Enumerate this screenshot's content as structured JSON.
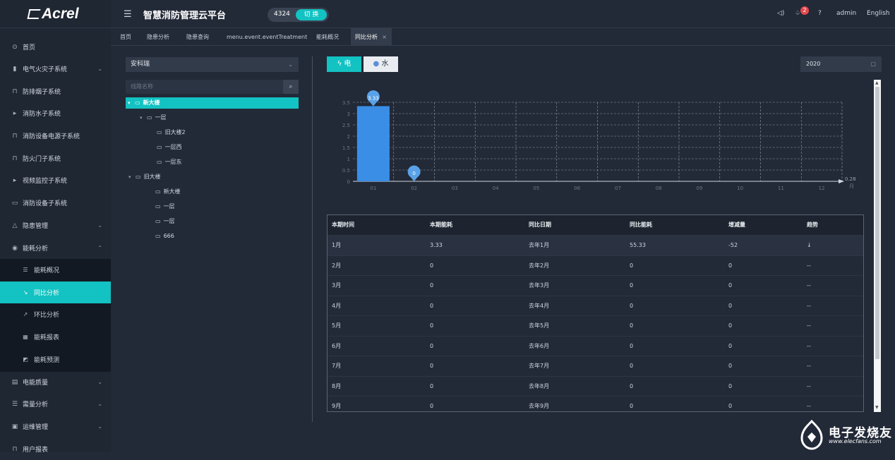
{
  "brand": {
    "logo_text": "Acrel"
  },
  "header": {
    "title": "智慧消防管理云平台",
    "project_id": "4324",
    "switch_label": "切 换",
    "notification_count": "2",
    "user": "admin",
    "language": "English",
    "icons": [
      "speaker-icon",
      "bell-icon",
      "help-icon"
    ]
  },
  "sidebar": {
    "items": [
      {
        "label": "首页",
        "icon": "home-icon",
        "glyph": "⊙"
      },
      {
        "label": "电气火灾子系统",
        "icon": "chart-icon",
        "glyph": "▮"
      },
      {
        "label": "防排烟子系统",
        "icon": "lock-icon",
        "glyph": "⊓"
      },
      {
        "label": "消防水子系统",
        "icon": "play-icon",
        "glyph": "▸"
      },
      {
        "label": "消防设备电源子系统",
        "icon": "lock-icon",
        "glyph": "⊓"
      },
      {
        "label": "防火门子系统",
        "icon": "lock-icon",
        "glyph": "⊓"
      },
      {
        "label": "视频监控子系统",
        "icon": "play-icon",
        "glyph": "▸"
      },
      {
        "label": "消防设备子系统",
        "icon": "video-icon",
        "glyph": "▭"
      },
      {
        "label": "隐患管理",
        "icon": "warning-icon",
        "glyph": "△"
      },
      {
        "label": "能耗分析",
        "icon": "signal-icon",
        "glyph": "◉"
      }
    ],
    "energy_sub": [
      {
        "label": "能耗概况",
        "icon": "list-icon",
        "glyph": "☰"
      },
      {
        "label": "同比分析",
        "icon": "trend-down-icon",
        "glyph": "↘"
      },
      {
        "label": "环比分析",
        "icon": "trend-up-icon",
        "glyph": "↗"
      },
      {
        "label": "能耗报表",
        "icon": "bar-chart-icon",
        "glyph": "▦"
      },
      {
        "label": "能耗预测",
        "icon": "area-chart-icon",
        "glyph": "◩"
      }
    ],
    "items_after": [
      {
        "label": "电能质量",
        "icon": "calendar-icon",
        "glyph": "▤"
      },
      {
        "label": "需量分析",
        "icon": "list-icon",
        "glyph": "☰"
      },
      {
        "label": "运维管理",
        "icon": "image-icon",
        "glyph": "▣"
      },
      {
        "label": "用户报表",
        "icon": "lock-icon",
        "glyph": "⊓"
      }
    ]
  },
  "tabs": [
    "首页",
    "隐患分析",
    "隐患查询",
    "menu.event.eventTreatment",
    "能耗概况",
    "同比分析"
  ],
  "active_tab_close": "×",
  "tree": {
    "site_select": "安科瑞",
    "search_placeholder": "线路名称",
    "nodes": [
      {
        "label": "新大楼",
        "level": 0,
        "expanded": true,
        "selected": true
      },
      {
        "label": "一层",
        "level": 1,
        "expanded": true
      },
      {
        "label": "旧大楼2",
        "level": 2
      },
      {
        "label": "一层西",
        "level": 2
      },
      {
        "label": "一层东",
        "level": 2
      },
      {
        "label": "旧大楼",
        "level": 0,
        "expanded": true
      },
      {
        "label": "新大楼",
        "level": 1
      },
      {
        "label": "一层",
        "level": 1
      },
      {
        "label": "一层",
        "level": 1
      },
      {
        "label": "666",
        "level": 1
      }
    ]
  },
  "energy_buttons": {
    "electric": "电",
    "water": "水"
  },
  "year_picker": "2020",
  "chart_data": {
    "type": "bar",
    "categories": [
      "01",
      "02",
      "03",
      "04",
      "05",
      "06",
      "07",
      "08",
      "09",
      "10",
      "11",
      "12"
    ],
    "values": [
      3.33,
      0,
      null,
      null,
      null,
      null,
      null,
      null,
      null,
      null,
      null,
      null
    ],
    "data_labels": [
      "3.33",
      "0"
    ],
    "y_ticks": [
      "0",
      "0.5",
      "1",
      "1.5",
      "2",
      "2.5",
      "3",
      "3.5"
    ],
    "ylim": [
      0,
      3.5
    ],
    "trend_value": "0.28",
    "x_unit": "月",
    "grid": true,
    "bar_color": "#3a8ee6"
  },
  "table": {
    "headers": [
      "本期时间",
      "本期能耗",
      "同比日期",
      "同比能耗",
      "增减量",
      "趋势"
    ],
    "rows": [
      [
        "1月",
        "3.33",
        "去年1月",
        "55.33",
        "-52",
        "↓"
      ],
      [
        "2月",
        "0",
        "去年2月",
        "0",
        "0",
        "--"
      ],
      [
        "3月",
        "0",
        "去年3月",
        "0",
        "0",
        "--"
      ],
      [
        "4月",
        "0",
        "去年4月",
        "0",
        "0",
        "--"
      ],
      [
        "5月",
        "0",
        "去年5月",
        "0",
        "0",
        "--"
      ],
      [
        "6月",
        "0",
        "去年6月",
        "0",
        "0",
        "--"
      ],
      [
        "7月",
        "0",
        "去年7月",
        "0",
        "0",
        "--"
      ],
      [
        "8月",
        "0",
        "去年8月",
        "0",
        "0",
        "--"
      ],
      [
        "9月",
        "0",
        "去年9月",
        "0",
        "0",
        "--"
      ]
    ]
  },
  "watermark": {
    "cn": "电子发烧友",
    "url": "www.elecfans.com"
  },
  "colors": {
    "accent": "#13c2c2",
    "bg": "#222937",
    "sidebar": "#1f2733",
    "badge": "#e5484d"
  }
}
